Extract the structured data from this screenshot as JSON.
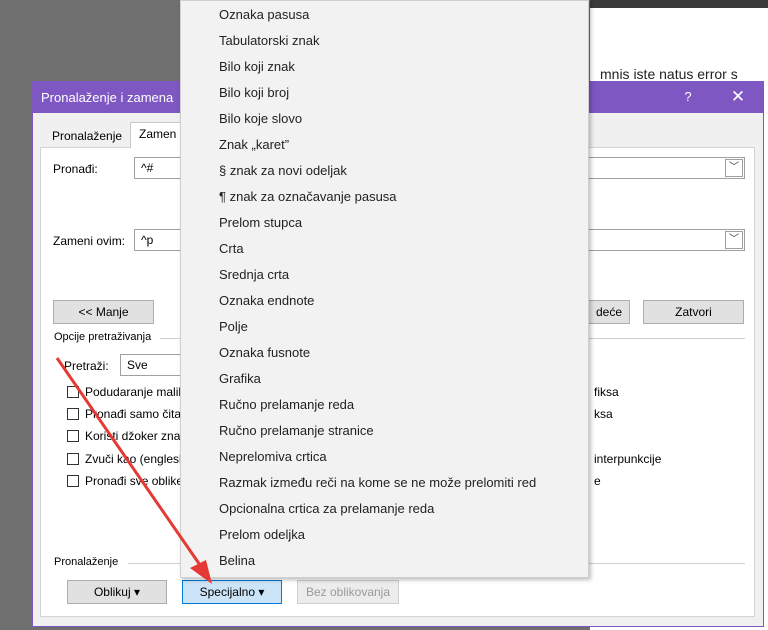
{
  "background_doc": {
    "text": "mnis iste natus error s"
  },
  "dialog": {
    "title": "Pronalaženje i zamena",
    "help": "?",
    "close": "✕",
    "tabs": [
      {
        "label": "Pronalaženje"
      },
      {
        "label": "Zamen"
      }
    ],
    "find_label": "Pronađi:",
    "find_value": "^#",
    "replace_label": "Zameni ovim:",
    "replace_value": "^p",
    "less_button": "<< Manje",
    "next_button": "deće",
    "close_button": "Zatvori",
    "options_title": "Opcije pretraživanja",
    "search_label": "Pretraži:",
    "search_value": "Sve",
    "options_left": [
      "Podudaranje malih",
      "Pronađi samo čitav",
      "Koristi džoker zna",
      "Zvuči kao (englesk",
      "Pronađi sve oblike"
    ],
    "options_right": [
      "fiksa",
      "ksa",
      "",
      "interpunkcije",
      "e"
    ],
    "find_section": "Pronalaženje",
    "format_button": "Oblikuj ▾",
    "special_button": "Specijalno ▾",
    "noformat_button": "Bez oblikovanja"
  },
  "special_menu": {
    "items": [
      "Oznaka pasusa",
      "Tabulatorski znak",
      "Bilo koji znak",
      "Bilo koji broj",
      "Bilo koje slovo",
      "Znak „karet”",
      "§ znak za novi odeljak",
      "¶ znak za označavanje pasusa",
      "Prelom stupca",
      "Crta",
      "Srednja crta",
      "Oznaka endnote",
      "Polje",
      "Oznaka fusnote",
      "Grafika",
      "Ručno prelamanje reda",
      "Ručno prelamanje stranice",
      "Neprelomiva crtica",
      "Razmak između reči na kome se ne može prelomiti red",
      "Opcionalna crtica za prelamanje reda",
      "Prelom odeljka",
      "Belina"
    ]
  },
  "colors": {
    "title_bar": "#7e57c2",
    "arrow": "#e53935",
    "special_button_bg": "#cce4f7"
  }
}
